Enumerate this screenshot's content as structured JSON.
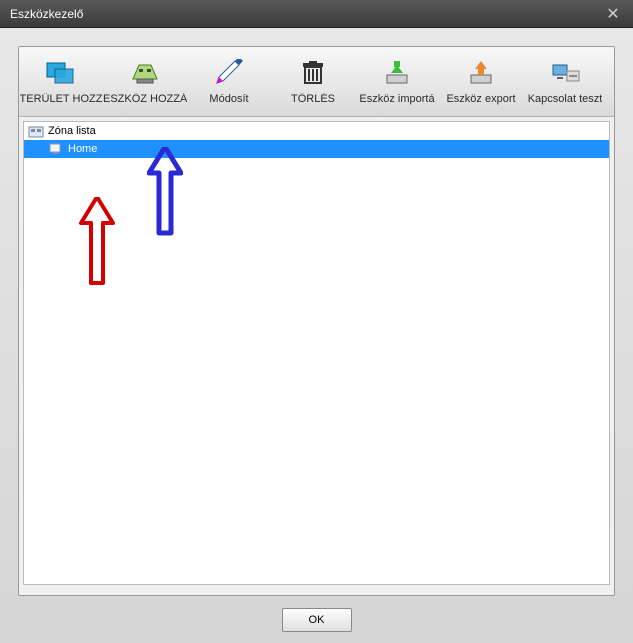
{
  "window": {
    "title": "Eszközkezelő"
  },
  "toolbar": {
    "items": [
      {
        "label": "TERÜLET HOZZ",
        "icon": "area-add"
      },
      {
        "label": "ESZKÖZ HOZZÁ",
        "icon": "device-add"
      },
      {
        "label": "Módosít",
        "icon": "edit"
      },
      {
        "label": "TÖRLÉS",
        "icon": "delete"
      },
      {
        "label": "Eszköz importá",
        "icon": "import"
      },
      {
        "label": "Eszköz export",
        "icon": "export"
      },
      {
        "label": "Kapcsolat teszt",
        "icon": "test"
      }
    ]
  },
  "tree": {
    "root": {
      "label": "Zóna lista"
    },
    "children": [
      {
        "label": "Home",
        "selected": true
      }
    ]
  },
  "footer": {
    "ok_label": "OK"
  }
}
